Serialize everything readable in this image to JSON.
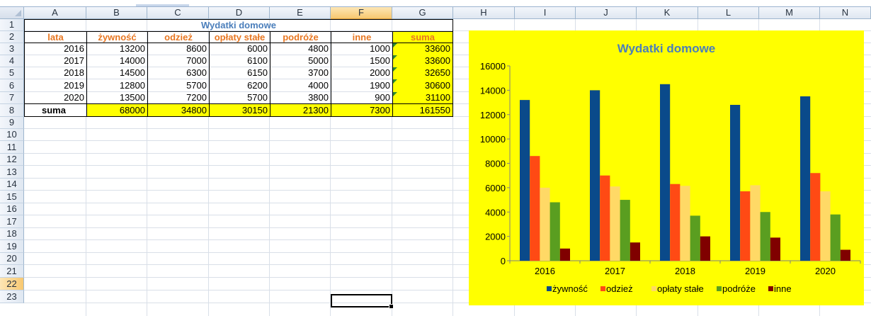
{
  "columns": [
    "A",
    "B",
    "C",
    "D",
    "E",
    "F",
    "G",
    "H",
    "I",
    "J",
    "K",
    "L",
    "M",
    "N"
  ],
  "rows": [
    "1",
    "2",
    "3",
    "4",
    "5",
    "6",
    "7",
    "8",
    "9",
    "10",
    "11",
    "12",
    "13",
    "14",
    "15",
    "16",
    "17",
    "18",
    "19",
    "20",
    "21",
    "22",
    "23"
  ],
  "sheet": {
    "title": "Wydatki domowe",
    "headers": [
      "lata",
      "żywność",
      "odzież",
      "opłaty stałe",
      "podróże",
      "inne",
      "suma"
    ],
    "data": [
      [
        "2016",
        "13200",
        "8600",
        "6000",
        "4800",
        "1000",
        "33600"
      ],
      [
        "2017",
        "14000",
        "7000",
        "6100",
        "5000",
        "1500",
        "33600"
      ],
      [
        "2018",
        "14500",
        "6300",
        "6150",
        "3700",
        "2000",
        "32650"
      ],
      [
        "2019",
        "12800",
        "5700",
        "6200",
        "4000",
        "1900",
        "30600"
      ],
      [
        "2020",
        "13500",
        "7200",
        "5700",
        "3800",
        "900",
        "31100"
      ]
    ],
    "totals": [
      "suma",
      "68000",
      "34800",
      "30150",
      "21300",
      "7300",
      "161550"
    ]
  },
  "colors": {
    "header_text": "#e87722",
    "title_text": "#4a7ebb",
    "highlight": "#ffff00"
  },
  "chart_data": {
    "type": "bar",
    "title": "Wydatki domowe",
    "categories": [
      "2016",
      "2017",
      "2018",
      "2019",
      "2020"
    ],
    "series": [
      {
        "name": "żywność",
        "color": "#0a4a8a",
        "values": [
          13200,
          14000,
          14500,
          12800,
          13500
        ]
      },
      {
        "name": "odzież",
        "color": "#ff4a14",
        "values": [
          8600,
          7000,
          6300,
          5700,
          7200
        ]
      },
      {
        "name": "opłaty stałe",
        "color": "#ffd966",
        "values": [
          6000,
          6100,
          6150,
          6200,
          5700
        ]
      },
      {
        "name": "podróże",
        "color": "#5a9e20",
        "values": [
          4800,
          5000,
          3700,
          4000,
          3800
        ]
      },
      {
        "name": "inne",
        "color": "#800000",
        "values": [
          1000,
          1500,
          2000,
          1900,
          900
        ]
      }
    ],
    "ylim": [
      0,
      16000
    ],
    "yticks": [
      "0",
      "2000",
      "4000",
      "6000",
      "8000",
      "10000",
      "12000",
      "14000",
      "16000"
    ],
    "grid": false,
    "legend": "bottom",
    "background": "#ffff00"
  }
}
